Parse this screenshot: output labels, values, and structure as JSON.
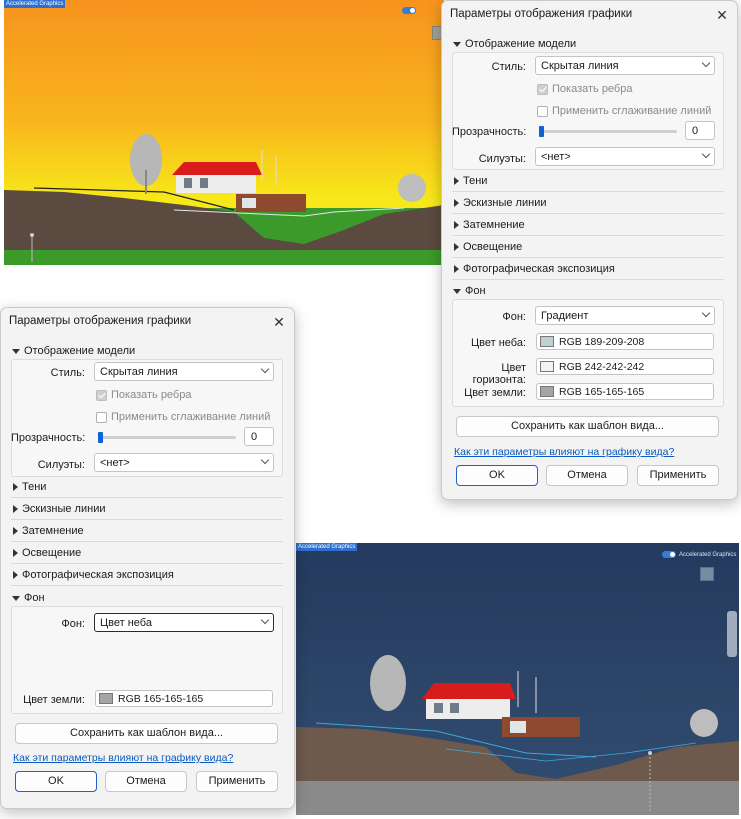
{
  "viewport_top": {
    "badge": "Accelerated Graphics",
    "sky_top": "#f7931e",
    "sky_bottom": "#f7e81a",
    "ground": "#3c9a2a"
  },
  "viewport_bottom": {
    "badge": "Accelerated Graphics",
    "toggle_label": "Accelerated Graphics",
    "sky_top": "#243a5e",
    "sky_bottom": "#324d73",
    "ground": "#8a8a8a"
  },
  "dialog_gradient": {
    "title": "Параметры отображения графики",
    "close": "✕",
    "model_section": "Отображение модели",
    "style_label": "Стиль:",
    "style_value": "Скрытая линия",
    "show_edges": "Показать ребра",
    "smooth_lines": "Применить сглаживание линий",
    "transparency_label": "Прозрачность:",
    "transparency_value": "0",
    "silhouettes_label": "Силуэты:",
    "silhouettes_value": "<нет>",
    "collapsed_sections": [
      "Тени",
      "Эскизные линии",
      "Затемнение",
      "Освещение",
      "Фотографическая экспозиция"
    ],
    "background_section": "Фон",
    "background_label": "Фон:",
    "background_value": "Градиент",
    "sky_label": "Цвет неба:",
    "sky_value": "RGB 189-209-208",
    "sky_color": "#bdd1d0",
    "horizon_label": "Цвет горизонта:",
    "horizon_value": "RGB 242-242-242",
    "horizon_color": "#f2f2f2",
    "ground_label": "Цвет земли:",
    "ground_value": "RGB 165-165-165",
    "ground_color": "#a5a5a5",
    "save_template": "Сохранить как шаблон вида...",
    "help_link": "Как эти параметры влияют на графику вида?",
    "ok": "OK",
    "cancel": "Отмена",
    "apply": "Применить"
  },
  "dialog_sky": {
    "title": "Параметры отображения графики",
    "close": "✕",
    "model_section": "Отображение модели",
    "style_label": "Стиль:",
    "style_value": "Скрытая линия",
    "show_edges": "Показать ребра",
    "smooth_lines": "Применить сглаживание линий",
    "transparency_label": "Прозрачность:",
    "transparency_value": "0",
    "silhouettes_label": "Силуэты:",
    "silhouettes_value": "<нет>",
    "collapsed_sections": [
      "Тени",
      "Эскизные линии",
      "Затемнение",
      "Освещение",
      "Фотографическая экспозиция"
    ],
    "background_section": "Фон",
    "background_label": "Фон:",
    "background_value": "Цвет неба",
    "ground_label": "Цвет земли:",
    "ground_value": "RGB 165-165-165",
    "ground_color": "#a5a5a5",
    "save_template": "Сохранить как шаблон вида...",
    "help_link": "Как эти параметры влияют на графику вида?",
    "ok": "OK",
    "cancel": "Отмена",
    "apply": "Применить"
  }
}
